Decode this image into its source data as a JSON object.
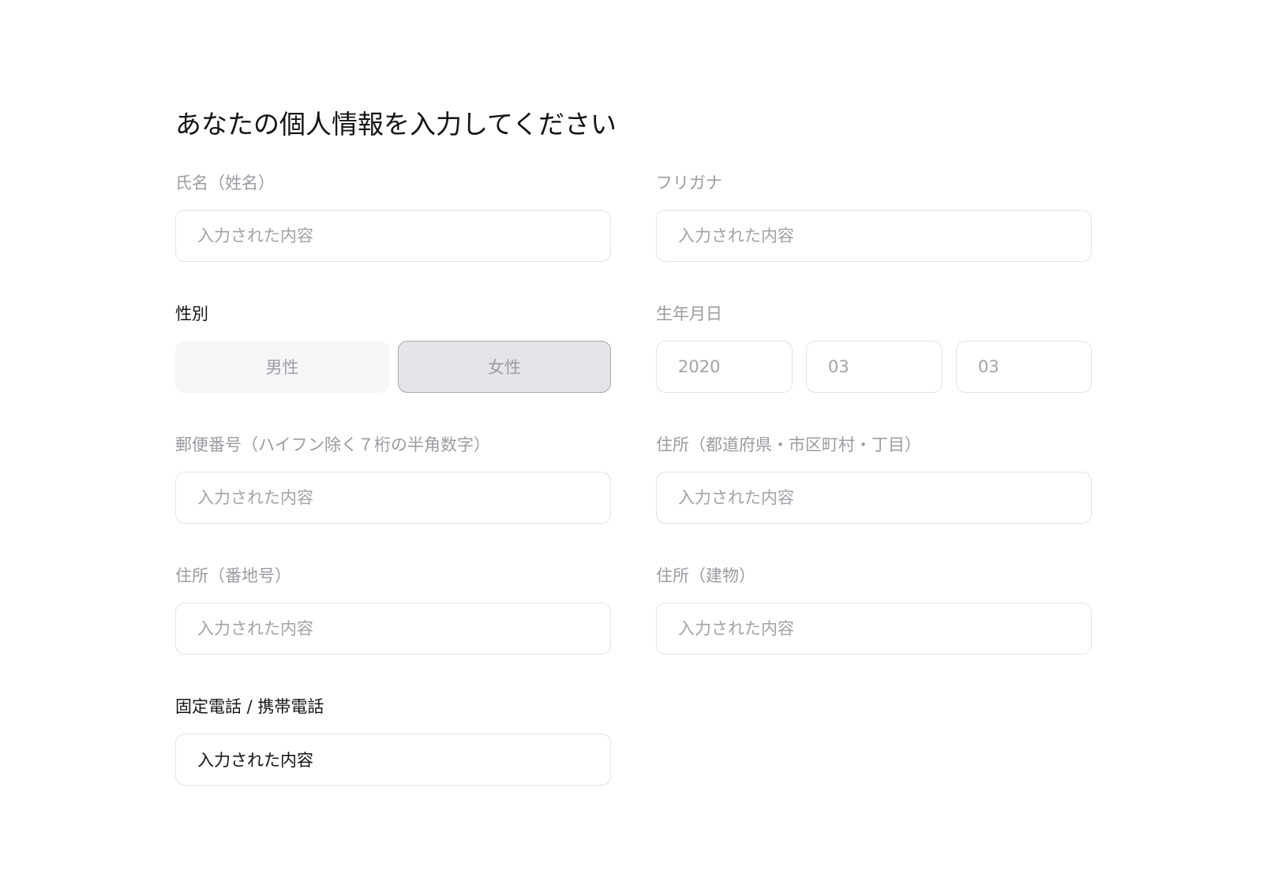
{
  "form": {
    "title": "あなたの個人情報を入力してください",
    "name": {
      "label": "氏名（姓名）",
      "placeholder": "入力された内容"
    },
    "furigana": {
      "label": "フリガナ",
      "placeholder": "入力された内容"
    },
    "gender": {
      "label": "性別",
      "options": [
        "男性",
        "女性"
      ],
      "selected": "女性"
    },
    "birthdate": {
      "label": "生年月日",
      "year_placeholder": "2020",
      "month_placeholder": "03",
      "day_placeholder": "03"
    },
    "postal_code": {
      "label": "郵便番号（ハイフン除く７桁の半角数字）",
      "placeholder": "入力された内容"
    },
    "address_region": {
      "label": "住所（都道府県・市区町村・丁目）",
      "placeholder": "入力された内容"
    },
    "address_number": {
      "label": "住所（番地号）",
      "placeholder": "入力された内容"
    },
    "address_building": {
      "label": "住所（建物）",
      "placeholder": "入力された内容"
    },
    "phone": {
      "label": "固定電話 / 携帯電話",
      "value": "入力された内容"
    }
  },
  "colors": {
    "label_inactive": "#9b9ba1",
    "label_active": "#151515",
    "input_border": "#e3e3e7",
    "gender_selected_bg": "#e4e4e9",
    "gender_selected_border": "#a6a6ae",
    "gender_unselected_bg": "#f6f6f8"
  }
}
